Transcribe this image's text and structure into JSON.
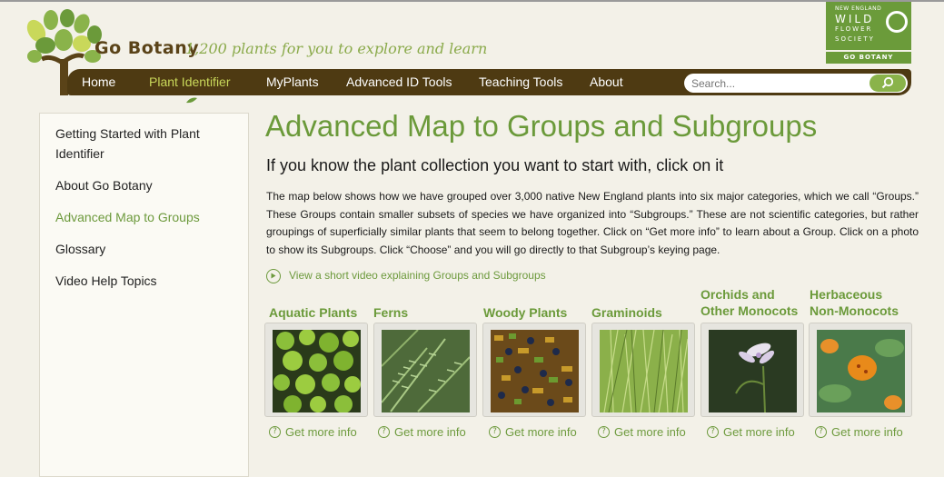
{
  "brand": {
    "name": "Go Botany",
    "tagline": "1,200 plants for you to explore and learn",
    "partner_line1": "NEW ENGLAND",
    "partner_line2": "WILD",
    "partner_line3": "FLOWER",
    "partner_line4": "SOCIETY",
    "partner_sub": "GO BOTANY"
  },
  "nav": {
    "items": [
      {
        "label": "Home"
      },
      {
        "label": "Plant Identifier"
      },
      {
        "label": "MyPlants"
      },
      {
        "label": "Advanced ID Tools"
      },
      {
        "label": "Teaching Tools"
      },
      {
        "label": "About"
      }
    ],
    "active": "Plant Identifier",
    "search_placeholder": "Search..."
  },
  "sidebar": {
    "items": [
      {
        "label": "Getting Started with Plant Identifier"
      },
      {
        "label": "About Go Botany"
      },
      {
        "label": "Advanced Map to Groups"
      },
      {
        "label": "Glossary"
      },
      {
        "label": "Video Help Topics"
      }
    ],
    "active": "Advanced Map to Groups"
  },
  "main": {
    "title": "Advanced Map to Groups and Subgroups",
    "subtitle": "If you know the plant collection you want to start with, click on it",
    "intro": "The map below shows how we have grouped over 3,000 native New England plants into six major categories, which we call “Groups.” These Groups contain smaller subsets of species we have organized into “Subgroups.” These are not scientific categories, but rather groupings of superficially similar plants that seem to belong together. Click on “Get more info” to learn about a Group. Click on a photo to show its Subgroups. Click “Choose” and you will go directly to that Subgroup’s keying page.",
    "video_link": "View a short video explaining Groups and Subgroups"
  },
  "groups": [
    {
      "name": "Aquatic Plants",
      "more": "Get more info"
    },
    {
      "name": "Ferns",
      "more": "Get more info"
    },
    {
      "name": "Woody Plants",
      "more": "Get more info"
    },
    {
      "name": "Graminoids",
      "more": "Get more info"
    },
    {
      "name_line1": "Orchids and",
      "name_line2": "Other Monocots",
      "more": "Get more info"
    },
    {
      "name_line1": "Herbaceous",
      "name_line2": "Non-Monocots",
      "more": "Get more info"
    }
  ],
  "colors": {
    "accent_green": "#6b9a3a",
    "nav_brown": "#4e3a12",
    "active_nav": "#c9d85a",
    "background": "#f3f1e8"
  }
}
